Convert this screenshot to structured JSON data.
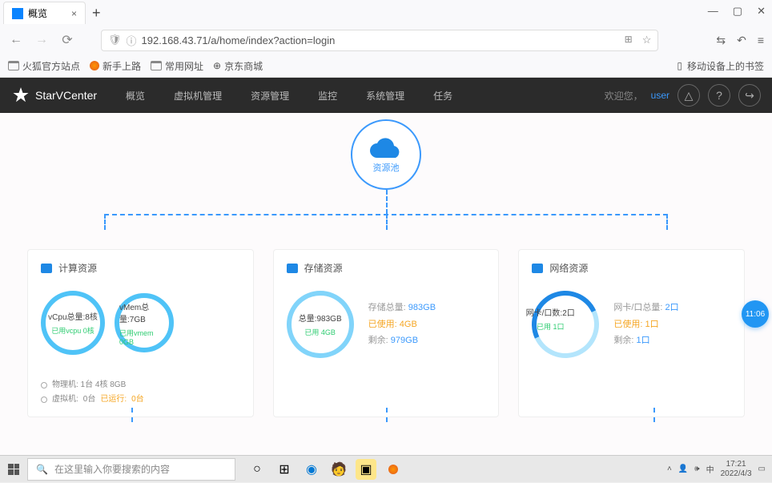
{
  "browser": {
    "tab_title": "概览",
    "url": "192.168.43.71/a/home/index?action=login",
    "bookmarks": [
      "火狐官方站点",
      "新手上路",
      "常用网址",
      "京东商城"
    ],
    "mobile_bm": "移动设备上的书签"
  },
  "header": {
    "brand": "StarVCenter",
    "nav": [
      "概览",
      "虚拟机管理",
      "资源管理",
      "监控",
      "系统管理",
      "任务"
    ],
    "welcome": "欢迎您，",
    "user": "user"
  },
  "pool": {
    "label": "资源池"
  },
  "cards": {
    "compute": {
      "title": "计算资源",
      "cpu_total": "vCpu总量:8核",
      "cpu_used": "已用vcpu 0核",
      "mem_total": "vMem总量:7GB",
      "mem_used": "已用vmem 0GB",
      "phys": "物理机: 1台 4核 8GB",
      "vm_lbl": "虚拟机:",
      "vm_cnt": "0台",
      "vm_run_lbl": "已运行:",
      "vm_run": "0台"
    },
    "storage": {
      "title": "存储资源",
      "total": "总量:983GB",
      "used": "已用 4GB",
      "s1_lbl": "存储总量:",
      "s1_v": "983GB",
      "s2_lbl": "已使用:",
      "s2_v": "4GB",
      "s3_lbl": "剩余:",
      "s3_v": "979GB"
    },
    "network": {
      "title": "网络资源",
      "total": "网卡/口数:2口",
      "used": "已用 1口",
      "s1_lbl": "网卡/口总量:",
      "s1_v": "2口",
      "s2_lbl": "已使用:",
      "s2_v": "1口",
      "s3_lbl": "剩余:",
      "s3_v": "1口"
    }
  },
  "badge": "11:06",
  "taskbar": {
    "search_ph": "在这里输入你要搜索的内容",
    "time": "17:21",
    "date": "2022/4/3"
  }
}
